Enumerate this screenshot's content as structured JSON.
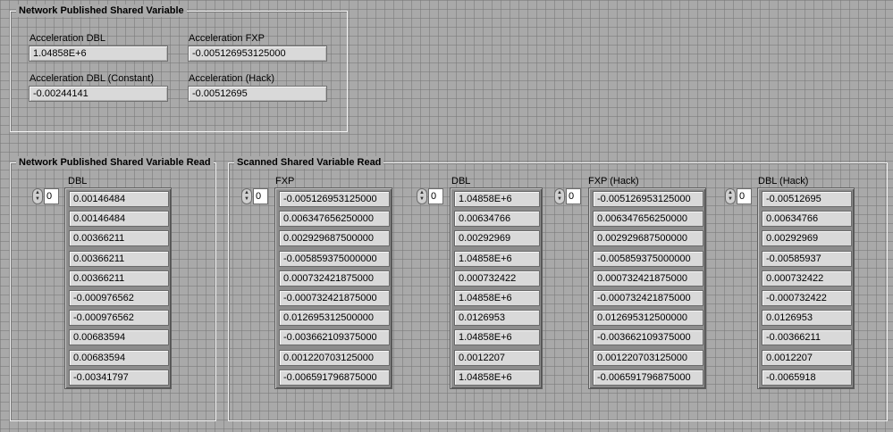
{
  "npsv": {
    "title": "Network Published Shared Variable",
    "fields": [
      {
        "label": "Acceleration DBL",
        "value": "1.04858E+6"
      },
      {
        "label": "Acceleration FXP",
        "value": "-0.005126953125000"
      },
      {
        "label": "Acceleration DBL (Constant)",
        "value": "-0.00244141"
      },
      {
        "label": "Acceleration (Hack)",
        "value": "-0.00512695"
      }
    ]
  },
  "npsv_read": {
    "title": "Network Published Shared Variable Read",
    "arrays": [
      {
        "label": "DBL",
        "index": "0",
        "values": [
          "0.00146484",
          "0.00146484",
          "0.00366211",
          "0.00366211",
          "0.00366211",
          "-0.000976562",
          "-0.000976562",
          "0.00683594",
          "0.00683594",
          "-0.00341797"
        ]
      }
    ]
  },
  "scanned": {
    "title": "Scanned Shared Variable Read",
    "arrays": [
      {
        "label": "FXP",
        "index": "0",
        "values": [
          "-0.005126953125000",
          "0.006347656250000",
          "0.002929687500000",
          "-0.005859375000000",
          "0.000732421875000",
          "-0.000732421875000",
          "0.012695312500000",
          "-0.003662109375000",
          "0.001220703125000",
          "-0.006591796875000"
        ]
      },
      {
        "label": "DBL",
        "index": "0",
        "values": [
          "1.04858E+6",
          "0.00634766",
          "0.00292969",
          "1.04858E+6",
          "0.000732422",
          "1.04858E+6",
          "0.0126953",
          "1.04858E+6",
          "0.0012207",
          "1.04858E+6"
        ]
      },
      {
        "label": "FXP (Hack)",
        "index": "0",
        "values": [
          "-0.005126953125000",
          "0.006347656250000",
          "0.002929687500000",
          "-0.005859375000000",
          "0.000732421875000",
          "-0.000732421875000",
          "0.012695312500000",
          "-0.003662109375000",
          "0.001220703125000",
          "-0.006591796875000"
        ]
      },
      {
        "label": "DBL (Hack)",
        "index": "0",
        "values": [
          "-0.00512695",
          "0.00634766",
          "0.00292969",
          "-0.00585937",
          "0.000732422",
          "-0.000732422",
          "0.0126953",
          "-0.00366211",
          "0.0012207",
          "-0.0065918"
        ]
      }
    ]
  }
}
